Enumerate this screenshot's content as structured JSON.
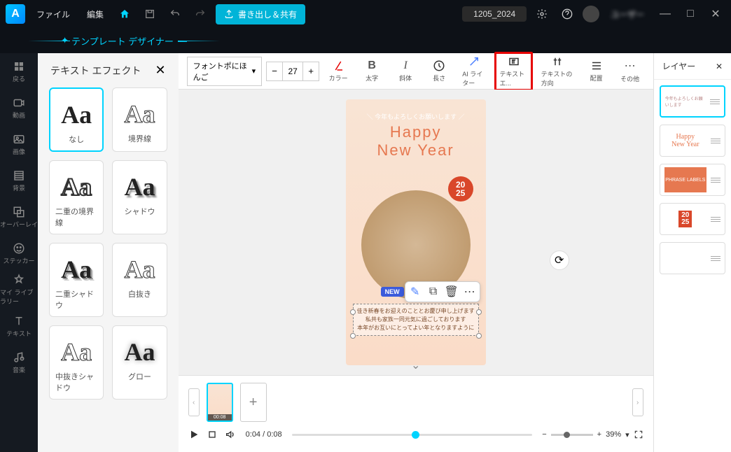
{
  "topbar": {
    "menu_file": "ファイル",
    "menu_edit": "編集",
    "export_label": "書き出し＆共有",
    "project_name": "1205_2024",
    "user_name": "ユーザー"
  },
  "designer_bar": "テンプレート デザイナー",
  "leftnav": {
    "back": "戻る",
    "video": "動画",
    "image": "画像",
    "bg": "背景",
    "overlay": "オーバーレイ",
    "sticker": "ステッカー",
    "library": "マイ ライブラリー",
    "text": "テキスト",
    "music": "音楽"
  },
  "effects": {
    "title": "テキスト エフェクト",
    "items": [
      "なし",
      "境界線",
      "二重の境界線",
      "シャドウ",
      "二重シャドウ",
      "白抜き",
      "中抜きシャドウ",
      "グロー"
    ]
  },
  "toolbar": {
    "font": "フォントポにほんご",
    "size": "27",
    "color": "カラー",
    "bold": "太字",
    "italic": "斜体",
    "length": "長さ",
    "ai": "AI ライター",
    "texteffect": "テキスト エ...",
    "direction": "テキストの方向",
    "align": "配置",
    "other": "その他"
  },
  "canvas": {
    "top_banner": "＼ 今年もよろしくお願いします ／",
    "title_l1": "Happy",
    "title_l2": "New Year",
    "year_top": "20",
    "year_bottom": "25",
    "new_badge": "NEW",
    "greeting": "佳き新春をお迎えのこととお慶び申し上げます\n私共も家族一同元気に過ごしております\n本年がお互いにとってよい年となりますように"
  },
  "timeline": {
    "thumb_time": "00:08",
    "current": "0:04",
    "total": "0:08",
    "zoom": "39%"
  },
  "layers": {
    "title": "レイヤー",
    "items": [
      {
        "label": "今年もよろしくお願いします"
      },
      {
        "label": "Happy New Year"
      },
      {
        "label": "PHRASE"
      },
      {
        "label": "2025"
      },
      {
        "label": ""
      }
    ]
  }
}
